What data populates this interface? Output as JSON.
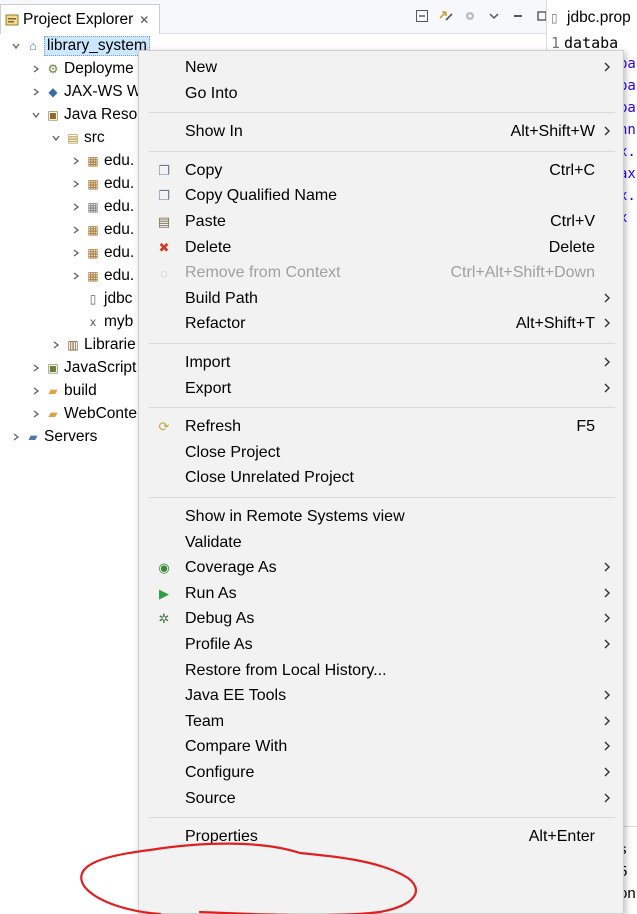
{
  "explorer": {
    "tab_label": "Project Explorer",
    "close_glyph": "✕",
    "tree": [
      {
        "label": "library_system",
        "depth": 0,
        "twisty": "v",
        "icon": "project-icon",
        "glyph": "⌂",
        "color": "#3b6ea5",
        "selected": true
      },
      {
        "label": "Deployme",
        "depth": 1,
        "twisty": ">",
        "icon": "deployment-descriptor-icon",
        "glyph": "⚙",
        "color": "#6b7b3a"
      },
      {
        "label": "JAX-WS W",
        "depth": 1,
        "twisty": ">",
        "icon": "web-services-icon",
        "glyph": "◆",
        "color": "#3b6ea5"
      },
      {
        "label": "Java Resou",
        "depth": 1,
        "twisty": "v",
        "icon": "java-resources-icon",
        "glyph": "▣",
        "color": "#8a6d2a"
      },
      {
        "label": "src",
        "depth": 2,
        "twisty": "v",
        "icon": "source-folder-icon",
        "glyph": "▤",
        "color": "#b08a2e"
      },
      {
        "label": "edu.",
        "depth": 3,
        "twisty": ">",
        "icon": "package-icon",
        "glyph": "▦",
        "color": "#a0702a"
      },
      {
        "label": "edu.",
        "depth": 3,
        "twisty": ">",
        "icon": "package-icon",
        "glyph": "▦",
        "color": "#a0702a"
      },
      {
        "label": "edu.",
        "depth": 3,
        "twisty": ">",
        "icon": "package-empty-icon",
        "glyph": "▦",
        "color": "#777777"
      },
      {
        "label": "edu.",
        "depth": 3,
        "twisty": ">",
        "icon": "package-icon",
        "glyph": "▦",
        "color": "#a0702a"
      },
      {
        "label": "edu.",
        "depth": 3,
        "twisty": ">",
        "icon": "package-icon",
        "glyph": "▦",
        "color": "#a0702a"
      },
      {
        "label": "edu.",
        "depth": 3,
        "twisty": ">",
        "icon": "package-icon",
        "glyph": "▦",
        "color": "#a0702a"
      },
      {
        "label": "jdbc",
        "depth": 3,
        "twisty": "",
        "icon": "properties-file-icon",
        "glyph": "▯",
        "color": "#666666"
      },
      {
        "label": "myb",
        "depth": 3,
        "twisty": "",
        "icon": "xml-file-icon",
        "glyph": "x",
        "color": "#555555"
      },
      {
        "label": "Librarie",
        "depth": 2,
        "twisty": ">",
        "icon": "libraries-icon",
        "glyph": "▥",
        "color": "#7b5a2a"
      },
      {
        "label": "JavaScript",
        "depth": 1,
        "twisty": ">",
        "icon": "javascript-resources-icon",
        "glyph": "▣",
        "color": "#6b7b3a"
      },
      {
        "label": "build",
        "depth": 1,
        "twisty": ">",
        "icon": "folder-icon",
        "glyph": "▰",
        "color": "#d9a441"
      },
      {
        "label": "WebConte",
        "depth": 1,
        "twisty": ">",
        "icon": "folder-icon",
        "glyph": "▰",
        "color": "#d9a441"
      },
      {
        "label": "Servers",
        "depth": 0,
        "twisty": ">",
        "icon": "servers-folder-icon",
        "glyph": "▰",
        "color": "#4a7ab5"
      }
    ]
  },
  "editor": {
    "tab_label": "jdbc.prop",
    "line_number": "1",
    "first_line": "databa",
    "fragments": [
      "pa",
      "pa",
      "pa",
      "nn",
      "x.",
      "ax",
      "x.n",
      "x"
    ],
    "bottom_fragments": [
      "s",
      "5",
      "on"
    ]
  },
  "menu": [
    {
      "type": "item",
      "label": "New",
      "submenu": true
    },
    {
      "type": "item",
      "label": "Go Into"
    },
    {
      "type": "sep"
    },
    {
      "type": "item",
      "label": "Show In",
      "shortcut": "Alt+Shift+W",
      "submenu": true
    },
    {
      "type": "sep"
    },
    {
      "type": "item",
      "label": "Copy",
      "shortcut": "Ctrl+C",
      "icon": "copy-icon",
      "glyph": "❐",
      "color": "#6b7a8f"
    },
    {
      "type": "item",
      "label": "Copy Qualified Name",
      "icon": "copy-qualified-name-icon",
      "glyph": "❐",
      "color": "#6b7a8f"
    },
    {
      "type": "item",
      "label": "Paste",
      "shortcut": "Ctrl+V",
      "icon": "paste-icon",
      "glyph": "▤",
      "color": "#7a6a4a"
    },
    {
      "type": "item",
      "label": "Delete",
      "shortcut": "Delete",
      "icon": "delete-icon",
      "glyph": "✖",
      "color": "#d23a2a"
    },
    {
      "type": "item",
      "label": "Remove from Context",
      "shortcut": "Ctrl+Alt+Shift+Down",
      "icon": "remove-from-context-icon",
      "glyph": "◌",
      "color": "#b0b0b0",
      "disabled": true
    },
    {
      "type": "item",
      "label": "Build Path",
      "submenu": true
    },
    {
      "type": "item",
      "label": "Refactor",
      "shortcut": "Alt+Shift+T",
      "submenu": true
    },
    {
      "type": "sep"
    },
    {
      "type": "item",
      "label": "Import",
      "submenu": true
    },
    {
      "type": "item",
      "label": "Export",
      "submenu": true
    },
    {
      "type": "sep"
    },
    {
      "type": "item",
      "label": "Refresh",
      "shortcut": "F5",
      "icon": "refresh-icon",
      "glyph": "⟳",
      "color": "#c9a13a"
    },
    {
      "type": "item",
      "label": "Close Project"
    },
    {
      "type": "item",
      "label": "Close Unrelated Project"
    },
    {
      "type": "sep"
    },
    {
      "type": "item",
      "label": "Show in Remote Systems view"
    },
    {
      "type": "item",
      "label": "Validate"
    },
    {
      "type": "item",
      "label": "Coverage As",
      "submenu": true,
      "icon": "coverage-icon",
      "glyph": "◉",
      "color": "#3a8a3a"
    },
    {
      "type": "item",
      "label": "Run As",
      "submenu": true,
      "icon": "run-icon",
      "glyph": "▶",
      "color": "#2e9e3e"
    },
    {
      "type": "item",
      "label": "Debug As",
      "submenu": true,
      "icon": "debug-icon",
      "glyph": "✲",
      "color": "#4a7a4a"
    },
    {
      "type": "item",
      "label": "Profile As",
      "submenu": true
    },
    {
      "type": "item",
      "label": "Restore from Local History..."
    },
    {
      "type": "item",
      "label": "Java EE Tools",
      "submenu": true
    },
    {
      "type": "item",
      "label": "Team",
      "submenu": true
    },
    {
      "type": "item",
      "label": "Compare With",
      "submenu": true
    },
    {
      "type": "item",
      "label": "Configure",
      "submenu": true
    },
    {
      "type": "item",
      "label": "Source",
      "submenu": true
    },
    {
      "type": "sep"
    },
    {
      "type": "item",
      "label": "Properties",
      "shortcut": "Alt+Enter"
    }
  ],
  "annotation": {
    "color": "#e02020"
  }
}
